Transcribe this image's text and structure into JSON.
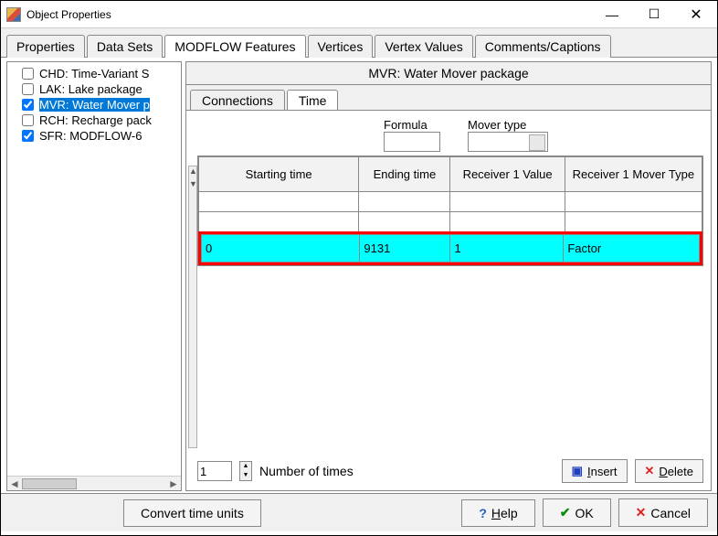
{
  "window": {
    "title": "Object Properties"
  },
  "tabs": {
    "items": [
      "Properties",
      "Data Sets",
      "MODFLOW Features",
      "Vertices",
      "Vertex Values",
      "Comments/Captions"
    ],
    "active_index": 2
  },
  "tree": {
    "items": [
      {
        "checked": false,
        "label": "CHD: Time-Variant S"
      },
      {
        "checked": false,
        "label": "LAK: Lake package"
      },
      {
        "checked": true,
        "label": "MVR: Water Mover p",
        "selected": true
      },
      {
        "checked": false,
        "label": "RCH: Recharge pack"
      },
      {
        "checked": true,
        "label": "SFR: MODFLOW-6"
      }
    ]
  },
  "panel": {
    "title": "MVR: Water Mover package",
    "subtabs": {
      "items": [
        "Connections",
        "Time"
      ],
      "active_index": 1
    },
    "header_labels": {
      "formula": "Formula",
      "mover_type": "Mover type"
    },
    "grid": {
      "columns": [
        "Starting time",
        "Ending time",
        "Receiver 1 Value",
        "Receiver 1 Mover Type"
      ],
      "highlighted_row": {
        "starting_time": "0",
        "ending_time": "9131",
        "r1_value": "1",
        "r1_mover": "Factor"
      }
    },
    "footer": {
      "count_value": "1",
      "count_label": "Number of times",
      "insert": "Insert",
      "delete": "Delete"
    }
  },
  "buttons": {
    "convert": "Convert time units",
    "help": "Help",
    "ok": "OK",
    "cancel": "Cancel"
  }
}
